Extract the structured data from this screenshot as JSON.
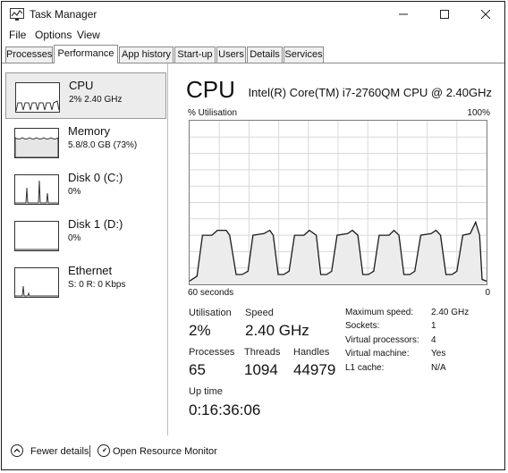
{
  "window": {
    "title": "Task Manager"
  },
  "menu": [
    "File",
    "Options",
    "View"
  ],
  "tabs": [
    "Processes",
    "Performance",
    "App history",
    "Start-up",
    "Users",
    "Details",
    "Services"
  ],
  "active_tab": "Performance",
  "sidebar": [
    {
      "name": "CPU",
      "value": "2% 2.40 GHz"
    },
    {
      "name": "Memory",
      "value": "5.8/8.0 GB (73%)"
    },
    {
      "name": "Disk 0 (C:)",
      "value": "0%"
    },
    {
      "name": "Disk 1 (D:)",
      "value": "0%"
    },
    {
      "name": "Ethernet",
      "value": "S: 0 R: 0 Kbps"
    }
  ],
  "main": {
    "title": "CPU",
    "model": "Intel(R) Core(TM) i7-2760QM CPU @ 2.40GHz",
    "graph": {
      "ylabel": "% Utilisation",
      "ymax_label": "100%",
      "xlabel": "60 seconds",
      "xmin_label": "0"
    },
    "stats": {
      "utilisation_label": "Utilisation",
      "utilisation": "2%",
      "speed_label": "Speed",
      "speed": "2.40 GHz",
      "processes_label": "Processes",
      "processes": "65",
      "threads_label": "Threads",
      "threads": "1094",
      "handles_label": "Handles",
      "handles": "44979",
      "uptime_label": "Up time",
      "uptime": "0:16:36:06"
    },
    "specs": [
      {
        "label": "Maximum speed:",
        "value": "2.40 GHz"
      },
      {
        "label": "Sockets:",
        "value": "1"
      },
      {
        "label": "Virtual processors:",
        "value": "4"
      },
      {
        "label": "Virtual machine:",
        "value": "Yes"
      },
      {
        "label": "L1 cache:",
        "value": "N/A"
      }
    ]
  },
  "footer": {
    "fewer_details": "Fewer details",
    "open_monitor": "Open Resource Monitor"
  },
  "chart_data": {
    "type": "area",
    "ylim": [
      0,
      100
    ],
    "grid": true,
    "points": [
      [
        0,
        2
      ],
      [
        1.5,
        5
      ],
      [
        2.6,
        30
      ],
      [
        4.5,
        30
      ],
      [
        5.6,
        33
      ],
      [
        7.4,
        33
      ],
      [
        8.1,
        30
      ],
      [
        9.4,
        6
      ],
      [
        10.6,
        6
      ],
      [
        11.8,
        8
      ],
      [
        12.8,
        30
      ],
      [
        15,
        31
      ],
      [
        16.2,
        33
      ],
      [
        16.9,
        30
      ],
      [
        17.9,
        6
      ],
      [
        19,
        6
      ],
      [
        20.1,
        8
      ],
      [
        21.2,
        30
      ],
      [
        23.1,
        30
      ],
      [
        24.2,
        33
      ],
      [
        25.6,
        30
      ],
      [
        26.5,
        6
      ],
      [
        27.7,
        6
      ],
      [
        28.7,
        8
      ],
      [
        29.8,
        30
      ],
      [
        31.9,
        31
      ],
      [
        32.9,
        33
      ],
      [
        34,
        30
      ],
      [
        35,
        6
      ],
      [
        36.1,
        6
      ],
      [
        37.2,
        8
      ],
      [
        38.3,
        30
      ],
      [
        40.3,
        30
      ],
      [
        41.3,
        33
      ],
      [
        42.3,
        30
      ],
      [
        43.3,
        6
      ],
      [
        44.5,
        6
      ],
      [
        45.5,
        8
      ],
      [
        46.7,
        30
      ],
      [
        48.8,
        31
      ],
      [
        49.8,
        33
      ],
      [
        50.7,
        30
      ],
      [
        51.8,
        6
      ],
      [
        53,
        6
      ],
      [
        54,
        8
      ],
      [
        55.2,
        30
      ],
      [
        56.7,
        31
      ],
      [
        57.8,
        38
      ],
      [
        58.6,
        30
      ],
      [
        59.1,
        3
      ],
      [
        60,
        2
      ]
    ]
  }
}
